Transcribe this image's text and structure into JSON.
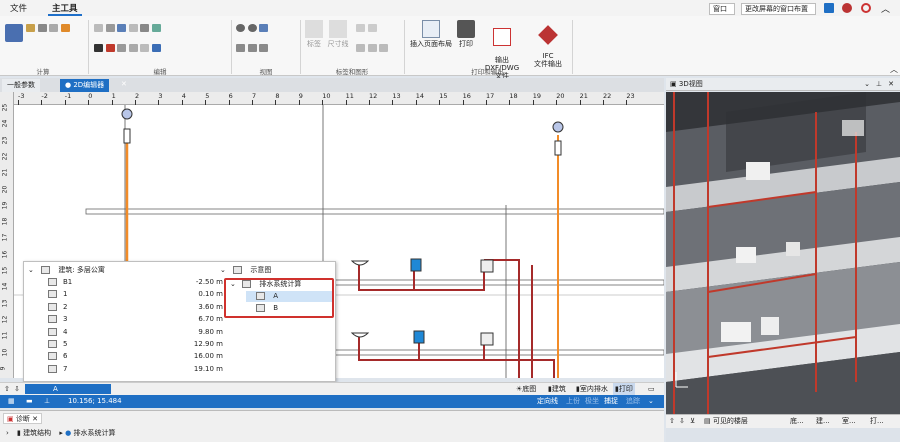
{
  "menubar": {
    "tab_file": "文件",
    "tab_main": "主工具",
    "window_menu": "窗口",
    "layout_select": "更改屏幕的窗口布置"
  },
  "ribbon": {
    "groups": {
      "calc": "计算",
      "edit": "编辑",
      "view": "视图",
      "labels": "标签和图形",
      "print": "打印和输出"
    },
    "labels_small": {
      "label": "标签",
      "dimension": "尺寸线"
    },
    "insert_page_layout": "插入页面布局",
    "print": "打印",
    "export_dxf": "输出 DXF/DWG\n文件",
    "export_ifc": "IFC\n文件输出"
  },
  "doc_tabs": {
    "general": "一般参数",
    "editor": "● 2D编辑器"
  },
  "ruler": {
    "x_ticks": [
      "-3",
      "-2",
      "-1",
      "0",
      "1",
      "2",
      "3",
      "4",
      "5",
      "6",
      "7",
      "8",
      "9",
      "10",
      "11",
      "12",
      "13",
      "14",
      "15",
      "16",
      "17",
      "18",
      "19",
      "20",
      "21",
      "22",
      "23"
    ],
    "y_ticks": [
      "25",
      "24",
      "23",
      "22",
      "21",
      "20",
      "19",
      "18",
      "17",
      "16",
      "15",
      "14",
      "13",
      "12",
      "11",
      "10",
      "9"
    ]
  },
  "tree": {
    "building_label": "建筑: 多层公寓",
    "floors": [
      {
        "name": "B1",
        "elev": "-2.50 m"
      },
      {
        "name": "1",
        "elev": "0.10 m"
      },
      {
        "name": "2",
        "elev": "3.60 m"
      },
      {
        "name": "3",
        "elev": "6.70 m"
      },
      {
        "name": "4",
        "elev": "9.80 m"
      },
      {
        "name": "5",
        "elev": "12.90 m"
      },
      {
        "name": "6",
        "elev": "16.00 m"
      },
      {
        "name": "7",
        "elev": "19.10 m"
      }
    ],
    "schematic_label": "示意图",
    "drain_calc_label": "排水系统计算",
    "item_a": "A",
    "item_b": "B",
    "highlight_color": "#d0312d"
  },
  "view_bar": {
    "selector_value": "A",
    "floor": "底图",
    "building": "建筑",
    "indoor_drain": "室内排水",
    "print": "打印"
  },
  "status": {
    "coords": "10.156; 15.484",
    "def_line": "定向线",
    "upper": "上份",
    "ortho": "极坐",
    "capture": "捕捉",
    "snap": "追踪"
  },
  "bottom": {
    "tab_diag": "诊断",
    "item_structure": "建筑结构",
    "item_drain": "排水系统计算"
  },
  "view3d": {
    "title": "3D视图",
    "visible_floors": "可见的楼层",
    "btn_floor": "底...",
    "btn_build": "建...",
    "btn_room": "室...",
    "btn_print": "打..."
  },
  "colors": {
    "accent": "#1f6fc4",
    "pipe_red": "#a52a2a",
    "pipe_orange": "#f28c28"
  }
}
